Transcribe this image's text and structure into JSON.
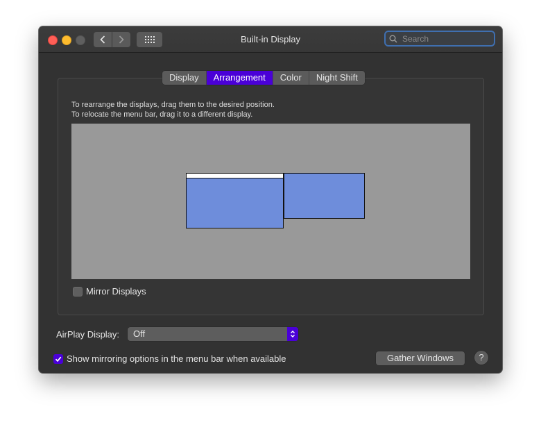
{
  "window": {
    "title": "Built-in Display",
    "search": {
      "placeholder": "Search"
    }
  },
  "tabs": [
    {
      "label": "Display"
    },
    {
      "label": "Arrangement",
      "active": true
    },
    {
      "label": "Color"
    },
    {
      "label": "Night Shift"
    }
  ],
  "arrangement": {
    "instruction_line1": "To rearrange the displays, drag them to the desired position.",
    "instruction_line2": "To relocate the menu bar, drag it to a different display.",
    "mirror_label": "Mirror Displays",
    "mirror_checked": false
  },
  "airplay": {
    "label": "AirPlay Display:",
    "value": "Off"
  },
  "show_mirroring": {
    "label": "Show mirroring options in the menu bar when available",
    "checked": true
  },
  "buttons": {
    "gather_windows": "Gather Windows",
    "help": "?"
  },
  "colors": {
    "accent": "#4a00d8",
    "display_fill": "#6e8ddb",
    "arrangement_bg": "#999999",
    "window_bg": "#323232"
  },
  "icons": {
    "back": "chevron-left-icon",
    "forward": "chevron-right-icon",
    "show_all": "grid-icon",
    "search": "magnifier-icon",
    "popup": "up-down-chevron-icon",
    "checkmark": "checkmark-icon"
  }
}
